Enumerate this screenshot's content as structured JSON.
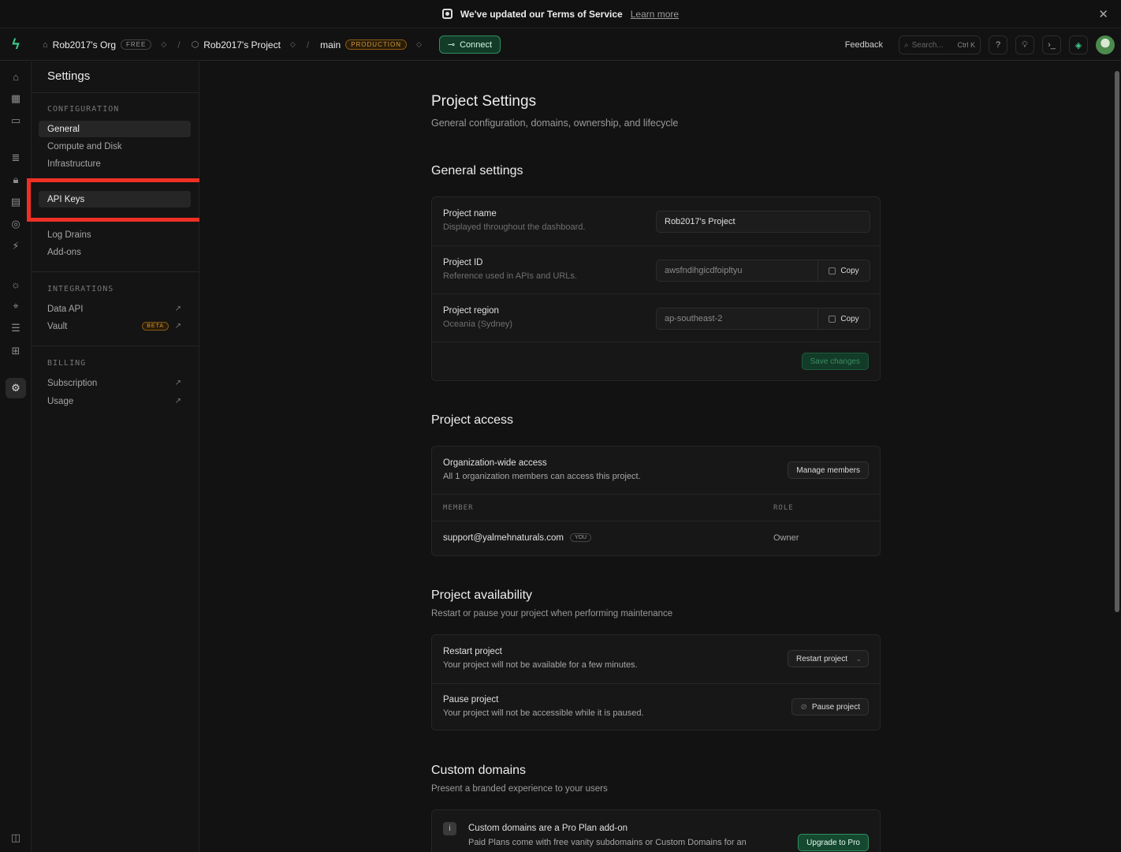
{
  "banner": {
    "text": "We've updated our Terms of Service",
    "link": "Learn more"
  },
  "header": {
    "org": "Rob2017's Org",
    "org_plan": "FREE",
    "project": "Rob2017's Project",
    "branch": "main",
    "branch_env": "PRODUCTION",
    "connect": "Connect",
    "feedback": "Feedback",
    "search_placeholder": "Search...",
    "search_shortcut": "Ctrl K"
  },
  "sidebar": {
    "title": "Settings",
    "sections": {
      "configuration": "CONFIGURATION",
      "integrations": "INTEGRATIONS",
      "billing": "BILLING"
    },
    "configuration_items": [
      "General",
      "Compute and Disk",
      "Infrastructure",
      "API Keys",
      "Log Drains",
      "Add-ons"
    ],
    "integration_items": [
      "Data API",
      "Vault"
    ],
    "vault_badge": "BETA",
    "billing_items": [
      "Subscription",
      "Usage"
    ]
  },
  "page": {
    "title": "Project Settings",
    "subtitle": "General configuration, domains, ownership, and lifecycle"
  },
  "general": {
    "heading": "General settings",
    "name_label": "Project name",
    "name_desc": "Displayed throughout the dashboard.",
    "name_value": "Rob2017's Project",
    "id_label": "Project ID",
    "id_desc": "Reference used in APIs and URLs.",
    "id_value": "awsfndihgicdfoipltyu",
    "region_label": "Project region",
    "region_desc": "Oceania (Sydney)",
    "region_value": "ap-southeast-2",
    "copy": "Copy",
    "save": "Save changes"
  },
  "access": {
    "heading": "Project access",
    "org_label": "Organization-wide access",
    "org_desc": "All 1 organization members can access this project.",
    "manage": "Manage members",
    "col_member": "MEMBER",
    "col_role": "ROLE",
    "member_email": "support@yalmehnaturals.com",
    "member_badge": "YOU",
    "member_role": "Owner"
  },
  "availability": {
    "heading": "Project availability",
    "subtitle": "Restart or pause your project when performing maintenance",
    "restart_label": "Restart project",
    "restart_desc": "Your project will not be available for a few minutes.",
    "restart_btn": "Restart project",
    "pause_label": "Pause project",
    "pause_desc": "Your project will not be accessible while it is paused.",
    "pause_btn": "Pause project"
  },
  "domains": {
    "heading": "Custom domains",
    "subtitle": "Present a branded experience to your users",
    "notice_title": "Custom domains are a Pro Plan add-on",
    "notice_desc": "Paid Plans come with free vanity subdomains or Custom Domains for an",
    "upgrade": "Upgrade to Pro"
  },
  "colors": {
    "accent": "#3ecf8e",
    "annotation": "#ee3024",
    "warning": "#d29a39"
  }
}
